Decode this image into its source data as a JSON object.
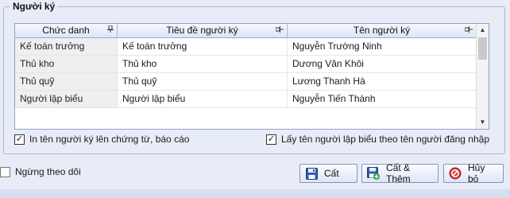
{
  "group": {
    "title": "Người ký"
  },
  "grid": {
    "columns": [
      "Chức danh",
      "Tiêu đề người ký",
      "Tên người ký"
    ],
    "rows": [
      [
        "Kế toán trưởng",
        "Kế toán trưởng",
        "Nguyễn Trường Ninh"
      ],
      [
        "Thủ kho",
        "Thủ kho",
        "Dương Văn Khôi"
      ],
      [
        "Thủ quỹ",
        "Thủ quỹ",
        "Lương Thanh Hà"
      ],
      [
        "Người lập biểu",
        "Người lập biểu",
        "Nguyễn Tiến Thành"
      ]
    ]
  },
  "options": {
    "print_signer": {
      "label": "In tên người ký lên chứng từ, báo cáo",
      "checked": true
    },
    "use_login_name": {
      "label": "Lấy tên người lập biểu theo tên người đăng nhập",
      "checked": true
    }
  },
  "footer": {
    "stop_tracking": {
      "label": "Ngừng theo dõi",
      "checked": false
    }
  },
  "buttons": {
    "save": "Cất",
    "save_add": "Cất & Thêm",
    "cancel": "Hủy bỏ"
  },
  "icons": {
    "save": "floppy-disk-icon",
    "save_add": "floppy-disk-plus-icon",
    "cancel": "no-entry-icon",
    "pin": "pin-icon"
  }
}
